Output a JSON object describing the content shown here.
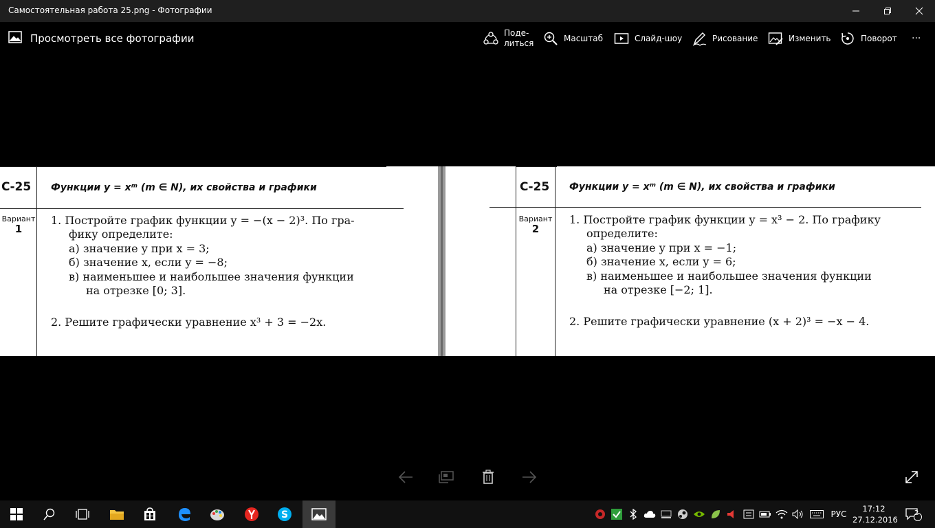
{
  "window": {
    "title": "Самостоятельная работа 25.png - Фотографии"
  },
  "toolbar": {
    "view_all": "Просмотреть все фотографии",
    "share_line1": "Поде-",
    "share_line2": "литься",
    "zoom": "Масштаб",
    "slideshow": "Слайд-шоу",
    "draw": "Рисование",
    "edit": "Изменить",
    "rotate": "Поворот",
    "more": "···"
  },
  "photo": {
    "left": {
      "code": "С-25",
      "heading": "Функции y = xᵐ (m ∈ N), их свойства и графики",
      "variant_label": "Вариант",
      "variant_num": "1",
      "lines": [
        "1. Постройте график функции y = −(x − 2)³. По гра-",
        "фику определите:",
        "а) значение y при x = 3;",
        "б) значение x, если y = −8;",
        "в) наименьшее и наибольшее значения функции",
        "на отрезке [0; 3].",
        "2. Решите графически уравнение x³ + 3 = −2x."
      ]
    },
    "right": {
      "code": "С-25",
      "heading": "Функции y = xᵐ (m ∈ N), их свойства и графики",
      "variant_label": "Вариант",
      "variant_num": "2",
      "lines": [
        "1. Постройте график функции y = x³ − 2. По графику",
        "определите:",
        "а) значение y при x = −1;",
        "б) значение x, если y = 6;",
        "в) наименьшее и наибольшее значения функции",
        "на отрезке [−2; 1].",
        "2. Решите графически уравнение (x + 2)³ = −x − 4."
      ]
    }
  },
  "taskbar": {
    "lang": "РУС",
    "time": "17:12",
    "date": "27.12.2016",
    "notifications": "2"
  },
  "colors": {
    "titlebar": "#1f1f1f",
    "background": "#000000",
    "taskbar": "#111111",
    "edge_blue": "#1e90ff",
    "skype_blue": "#00aff0",
    "yandex_red": "#e52620"
  }
}
